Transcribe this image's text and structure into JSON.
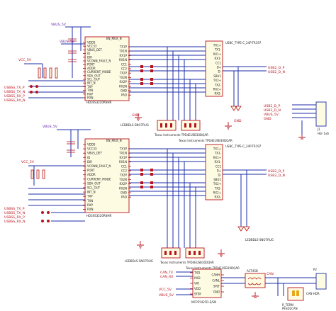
{
  "colors": {
    "wire": "#1c2ea8",
    "part": "#b8131e",
    "body": "#fdfbe2",
    "label": "#5a1ea8"
  },
  "top": {
    "mux_name": "EN_MUX_N",
    "mux_part": "HD3SS3220RNHR",
    "mux_left": [
      "VDDS",
      "VCC33",
      "VBUS_DET",
      "ID",
      "DIR",
      "VCONN_FAULT_N",
      "PORT",
      "ADDR",
      "CURRENT_MODE",
      "SDA_OUT",
      "SCL_OUT",
      "INT_N",
      "TXP",
      "TXN",
      "RXP",
      "RXN"
    ],
    "mux_right": [
      "TX1P",
      "TX1N",
      "RX1P",
      "RX1N",
      "CC1",
      "CC2",
      "TX2P",
      "TX2N",
      "RX2P",
      "RX2N",
      "GND",
      "PAD"
    ],
    "conn_name": "USBC_TYPE-C_24P-TR197",
    "conn_pins": [
      "TX1+",
      "TX1-",
      "RX1+",
      "RX1-",
      "CC1",
      "D+",
      "D-",
      "SBU1",
      "TX2+",
      "TX2-",
      "RX2+",
      "RX2-"
    ],
    "left_nets": [
      "VBUS_5V",
      "VCC_5V",
      "USBSS_TX_P",
      "USBSS_TX_N",
      "USBSS_RX_P",
      "USBSS_RX_N"
    ],
    "right_nets": [
      "USB2_D_P",
      "USB2_D_N"
    ],
    "esd_parts": [
      "Texas Instruments TPD4EUSB30DQAR",
      "Texas Instruments TPD4EUSB30DQAR"
    ],
    "esd_led": "LEDBDLS-SNO7RUG",
    "gnd": "GND",
    "vbus": "VBUS_5V"
  },
  "bottom": {
    "mux_name": "EN_MUX_N",
    "mux_part": "HD3SS3220RNHR",
    "mux_left": [
      "VDDS",
      "VCC33",
      "VBUS_DET",
      "ID",
      "DIR",
      "VCONN_FAULT_N",
      "PORT",
      "ADDR",
      "CURRENT_MODE",
      "SDA_OUT",
      "SCL_OUT",
      "INT_N",
      "TXP",
      "TXN",
      "RXP",
      "RXN"
    ],
    "mux_right": [
      "TX1P",
      "TX1N",
      "RX1P",
      "RX1N",
      "CC1",
      "CC2",
      "TX2P",
      "TX2N",
      "RX2P",
      "RX2N",
      "GND",
      "PAD"
    ],
    "conn_name": "USBC_TYPE-C_24P-TR197",
    "conn_pins": [
      "TX1+",
      "TX1-",
      "RX1+",
      "RX1-",
      "CC1",
      "D+",
      "D-",
      "SBU1",
      "TX2+",
      "TX2-",
      "RX2+",
      "RX2-"
    ],
    "left_nets": [
      "VBUS_5V",
      "VCC_5V",
      "USBSS_TX_P",
      "USBSS_TX_N",
      "USBSS_RX_P",
      "USBSS_RX_N"
    ],
    "right_nets": [
      "USB2_D_P",
      "USB2_D_N"
    ],
    "esd_parts": [
      "Texas Instruments TPD4EUSB30DQAR",
      "Texas Instruments TPD4EUSB30DQAR"
    ],
    "esd_led": "LEDBDLS-SNO7RUG",
    "gnd": "GND",
    "vbus": "VBUS_5V"
  },
  "right_header": {
    "nets": [
      "USB2_D_P",
      "USB2_D_N",
      "VBUS_5V",
      "GND"
    ],
    "name": "J1",
    "sub": "Hdr 1x6"
  },
  "can": {
    "chip_part": "MCP2542FD-E/SN",
    "chip_left": [
      "TXD",
      "RXD",
      "VIO",
      "VDD",
      "STBY"
    ],
    "chip_right": [
      "CANH",
      "CANL",
      "SPLT",
      "GND"
    ],
    "nets": [
      "CAN_TX",
      "CAN_RX",
      "VCC_5V",
      "VBUS_5V"
    ],
    "choke": "ACT45B",
    "term_name": "R_TERM",
    "term_part": "PESD2CAN",
    "term_net": "CAN",
    "out_name": "P2",
    "out_sub": "CAN HDR"
  }
}
